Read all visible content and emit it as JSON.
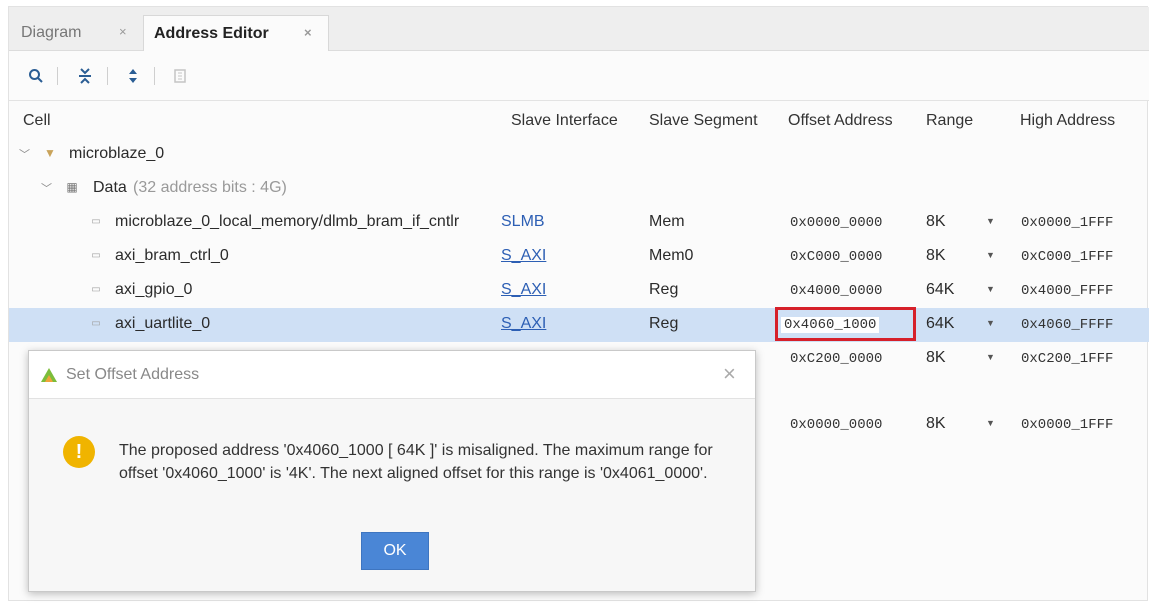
{
  "tabs": [
    {
      "label": "Diagram",
      "close": "×"
    },
    {
      "label": "Address Editor",
      "close": "×"
    }
  ],
  "table": {
    "headers": [
      "Cell",
      "Slave Interface",
      "Slave Segment",
      "Offset Address",
      "Range",
      "High Address"
    ],
    "root": {
      "label": "microblaze_0"
    },
    "group": {
      "label": "Data",
      "sub": "(32 address bits : 4G)"
    },
    "rows": [
      {
        "cell": "microblaze_0_local_memory/dlmb_bram_if_cntlr",
        "iface": "SLMB",
        "segment": "Mem",
        "offset": "0x0000_0000",
        "range": "8K",
        "high": "0x0000_1FFF"
      },
      {
        "cell": "axi_bram_ctrl_0",
        "iface": "S_AXI",
        "segment": "Mem0",
        "offset": "0xC000_0000",
        "range": "8K",
        "high": "0xC000_1FFF"
      },
      {
        "cell": "axi_gpio_0",
        "iface": "S_AXI",
        "segment": "Reg",
        "offset": "0x4000_0000",
        "range": "64K",
        "high": "0x4000_FFFF"
      },
      {
        "cell": "axi_uartlite_0",
        "iface": "S_AXI",
        "segment": "Reg",
        "offset": "0x4060_1000",
        "range": "64K",
        "high": "0x4060_FFFF"
      },
      {
        "offset": "0xC200_0000",
        "range": "8K",
        "high": "0xC200_1FFF"
      },
      {
        "offset": "0x0000_0000",
        "range": "8K",
        "high": "0x0000_1FFF"
      }
    ]
  },
  "dialog": {
    "title": "Set Offset Address",
    "close": "×",
    "message": "The proposed address '0x4060_1000 [ 64K ]' is misaligned. The maximum range for offset '0x4060_1000' is '4K'. The next aligned offset for this range is '0x4061_0000'.",
    "ok_label": "OK",
    "warn_glyph": "!"
  },
  "colors": {
    "selected_row": "#cfe0f5",
    "highlight": "#d6202a",
    "ok_button": "#4a86d6",
    "link": "#2d5fb4"
  }
}
